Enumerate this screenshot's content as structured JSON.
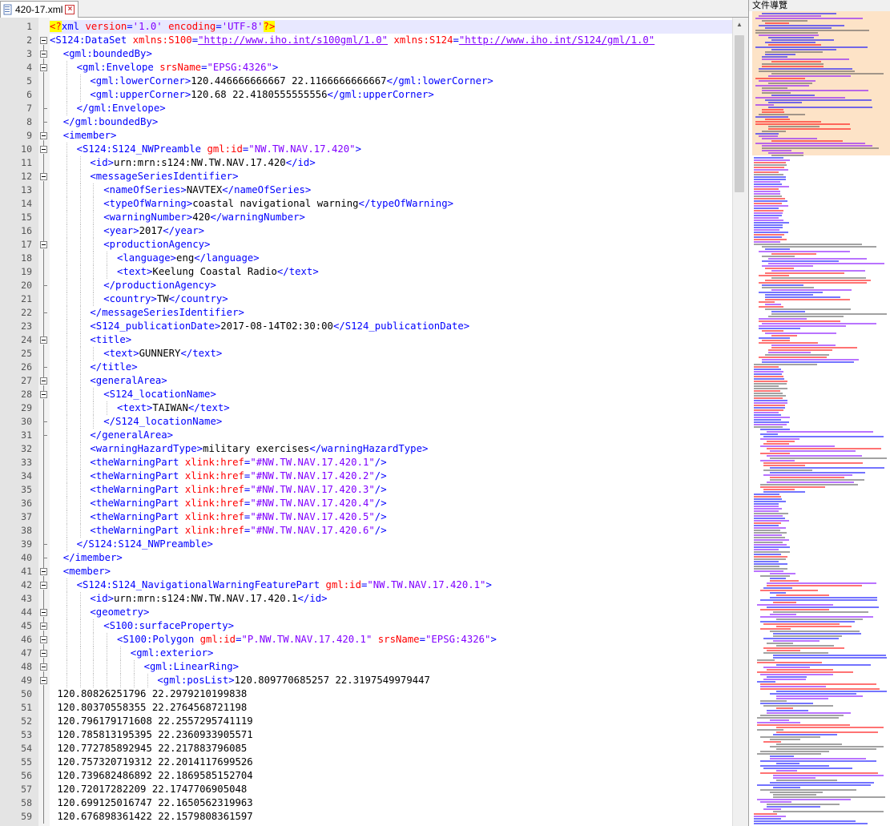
{
  "tab": {
    "filename": "420-17.xml",
    "close_symbol": "×"
  },
  "panel": {
    "title": "文件導覽"
  },
  "active_line": 1,
  "lines": [
    {
      "n": 1,
      "indent": 0,
      "segs": [
        [
          "pi",
          "<?"
        ],
        [
          "tag",
          "xml "
        ],
        [
          "attr",
          "version"
        ],
        [
          "tag",
          "="
        ],
        [
          "val",
          "'1.0'"
        ],
        [
          "tag",
          " "
        ],
        [
          "attr",
          "encoding"
        ],
        [
          "tag",
          "="
        ],
        [
          "val",
          "'UTF-8'"
        ],
        [
          "pi",
          "?>"
        ]
      ]
    },
    {
      "n": 2,
      "indent": 0,
      "fold": "open",
      "segs": [
        [
          "tag",
          "<S124:DataSet "
        ],
        [
          "attr",
          "xmlns:S100"
        ],
        [
          "tag",
          "="
        ],
        [
          "url",
          "\"http://www.iho.int/s100gml/1.0\""
        ],
        [
          "tag",
          " "
        ],
        [
          "attr",
          "xmlns:S124"
        ],
        [
          "tag",
          "="
        ],
        [
          "url",
          "\"http://www.iho.int/S124/gml/1.0\""
        ]
      ]
    },
    {
      "n": 3,
      "indent": 1,
      "fold": "open",
      "segs": [
        [
          "tag",
          "<gml:boundedBy>"
        ]
      ]
    },
    {
      "n": 4,
      "indent": 2,
      "fold": "open",
      "segs": [
        [
          "tag",
          "<gml:Envelope "
        ],
        [
          "attr",
          "srsName"
        ],
        [
          "tag",
          "="
        ],
        [
          "val",
          "\"EPSG:4326\""
        ],
        [
          "tag",
          ">"
        ]
      ]
    },
    {
      "n": 5,
      "indent": 3,
      "segs": [
        [
          "tag",
          "<gml:lowerCorner>"
        ],
        [
          "text",
          "120.446666666667 22.1166666666667"
        ],
        [
          "tag",
          "</gml:lowerCorner>"
        ]
      ]
    },
    {
      "n": 6,
      "indent": 3,
      "segs": [
        [
          "tag",
          "<gml:upperCorner>"
        ],
        [
          "text",
          "120.68 22.4180555555556"
        ],
        [
          "tag",
          "</gml:upperCorner>"
        ]
      ]
    },
    {
      "n": 7,
      "indent": 2,
      "fold": "end",
      "segs": [
        [
          "tag",
          "</gml:Envelope>"
        ]
      ]
    },
    {
      "n": 8,
      "indent": 1,
      "fold": "end",
      "segs": [
        [
          "tag",
          "</gml:boundedBy>"
        ]
      ]
    },
    {
      "n": 9,
      "indent": 1,
      "fold": "open",
      "segs": [
        [
          "tag",
          "<imember>"
        ]
      ]
    },
    {
      "n": 10,
      "indent": 2,
      "fold": "open",
      "segs": [
        [
          "tag",
          "<S124:S124_NWPreamble "
        ],
        [
          "attr",
          "gml:id"
        ],
        [
          "tag",
          "="
        ],
        [
          "val",
          "\"NW.TW.NAV.17.420\""
        ],
        [
          "tag",
          ">"
        ]
      ]
    },
    {
      "n": 11,
      "indent": 3,
      "segs": [
        [
          "tag",
          "<id>"
        ],
        [
          "text",
          "urn:mrn:s124:NW.TW.NAV.17.420"
        ],
        [
          "tag",
          "</id>"
        ]
      ]
    },
    {
      "n": 12,
      "indent": 3,
      "fold": "open",
      "segs": [
        [
          "tag",
          "<messageSeriesIdentifier>"
        ]
      ]
    },
    {
      "n": 13,
      "indent": 4,
      "segs": [
        [
          "tag",
          "<nameOfSeries>"
        ],
        [
          "text",
          "NAVTEX"
        ],
        [
          "tag",
          "</nameOfSeries>"
        ]
      ]
    },
    {
      "n": 14,
      "indent": 4,
      "segs": [
        [
          "tag",
          "<typeOfWarning>"
        ],
        [
          "text",
          "coastal navigational warning"
        ],
        [
          "tag",
          "</typeOfWarning>"
        ]
      ]
    },
    {
      "n": 15,
      "indent": 4,
      "segs": [
        [
          "tag",
          "<warningNumber>"
        ],
        [
          "text",
          "420"
        ],
        [
          "tag",
          "</warningNumber>"
        ]
      ]
    },
    {
      "n": 16,
      "indent": 4,
      "segs": [
        [
          "tag",
          "<year>"
        ],
        [
          "text",
          "2017"
        ],
        [
          "tag",
          "</year>"
        ]
      ]
    },
    {
      "n": 17,
      "indent": 4,
      "fold": "open",
      "segs": [
        [
          "tag",
          "<productionAgency>"
        ]
      ]
    },
    {
      "n": 18,
      "indent": 5,
      "segs": [
        [
          "tag",
          "<language>"
        ],
        [
          "text",
          "eng"
        ],
        [
          "tag",
          "</language>"
        ]
      ]
    },
    {
      "n": 19,
      "indent": 5,
      "segs": [
        [
          "tag",
          "<text>"
        ],
        [
          "text",
          "Keelung Coastal Radio"
        ],
        [
          "tag",
          "</text>"
        ]
      ]
    },
    {
      "n": 20,
      "indent": 4,
      "fold": "end",
      "segs": [
        [
          "tag",
          "</productionAgency>"
        ]
      ]
    },
    {
      "n": 21,
      "indent": 4,
      "segs": [
        [
          "tag",
          "<country>"
        ],
        [
          "text",
          "TW"
        ],
        [
          "tag",
          "</country>"
        ]
      ]
    },
    {
      "n": 22,
      "indent": 3,
      "fold": "end",
      "segs": [
        [
          "tag",
          "</messageSeriesIdentifier>"
        ]
      ]
    },
    {
      "n": 23,
      "indent": 3,
      "segs": [
        [
          "tag",
          "<S124_publicationDate>"
        ],
        [
          "text",
          "2017-08-14T02:30:00"
        ],
        [
          "tag",
          "</S124_publicationDate>"
        ]
      ]
    },
    {
      "n": 24,
      "indent": 3,
      "fold": "open",
      "segs": [
        [
          "tag",
          "<title>"
        ]
      ]
    },
    {
      "n": 25,
      "indent": 4,
      "segs": [
        [
          "tag",
          "<text>"
        ],
        [
          "text",
          "GUNNERY"
        ],
        [
          "tag",
          "</text>"
        ]
      ]
    },
    {
      "n": 26,
      "indent": 3,
      "fold": "end",
      "segs": [
        [
          "tag",
          "</title>"
        ]
      ]
    },
    {
      "n": 27,
      "indent": 3,
      "fold": "open",
      "segs": [
        [
          "tag",
          "<generalArea>"
        ]
      ]
    },
    {
      "n": 28,
      "indent": 4,
      "fold": "open",
      "segs": [
        [
          "tag",
          "<S124_locationName>"
        ]
      ]
    },
    {
      "n": 29,
      "indent": 5,
      "segs": [
        [
          "tag",
          "<text>"
        ],
        [
          "text",
          "TAIWAN"
        ],
        [
          "tag",
          "</text>"
        ]
      ]
    },
    {
      "n": 30,
      "indent": 4,
      "fold": "end",
      "segs": [
        [
          "tag",
          "</S124_locationName>"
        ]
      ]
    },
    {
      "n": 31,
      "indent": 3,
      "fold": "end",
      "segs": [
        [
          "tag",
          "</generalArea>"
        ]
      ]
    },
    {
      "n": 32,
      "indent": 3,
      "segs": [
        [
          "tag",
          "<warningHazardType>"
        ],
        [
          "text",
          "military exercises"
        ],
        [
          "tag",
          "</warningHazardType>"
        ]
      ]
    },
    {
      "n": 33,
      "indent": 3,
      "segs": [
        [
          "tag",
          "<theWarningPart "
        ],
        [
          "attr",
          "xlink:href"
        ],
        [
          "tag",
          "="
        ],
        [
          "val",
          "\"#NW.TW.NAV.17.420.1\""
        ],
        [
          "tag",
          "/>"
        ]
      ]
    },
    {
      "n": 34,
      "indent": 3,
      "segs": [
        [
          "tag",
          "<theWarningPart "
        ],
        [
          "attr",
          "xlink:href"
        ],
        [
          "tag",
          "="
        ],
        [
          "val",
          "\"#NW.TW.NAV.17.420.2\""
        ],
        [
          "tag",
          "/>"
        ]
      ]
    },
    {
      "n": 35,
      "indent": 3,
      "segs": [
        [
          "tag",
          "<theWarningPart "
        ],
        [
          "attr",
          "xlink:href"
        ],
        [
          "tag",
          "="
        ],
        [
          "val",
          "\"#NW.TW.NAV.17.420.3\""
        ],
        [
          "tag",
          "/>"
        ]
      ]
    },
    {
      "n": 36,
      "indent": 3,
      "segs": [
        [
          "tag",
          "<theWarningPart "
        ],
        [
          "attr",
          "xlink:href"
        ],
        [
          "tag",
          "="
        ],
        [
          "val",
          "\"#NW.TW.NAV.17.420.4\""
        ],
        [
          "tag",
          "/>"
        ]
      ]
    },
    {
      "n": 37,
      "indent": 3,
      "segs": [
        [
          "tag",
          "<theWarningPart "
        ],
        [
          "attr",
          "xlink:href"
        ],
        [
          "tag",
          "="
        ],
        [
          "val",
          "\"#NW.TW.NAV.17.420.5\""
        ],
        [
          "tag",
          "/>"
        ]
      ]
    },
    {
      "n": 38,
      "indent": 3,
      "segs": [
        [
          "tag",
          "<theWarningPart "
        ],
        [
          "attr",
          "xlink:href"
        ],
        [
          "tag",
          "="
        ],
        [
          "val",
          "\"#NW.TW.NAV.17.420.6\""
        ],
        [
          "tag",
          "/>"
        ]
      ]
    },
    {
      "n": 39,
      "indent": 2,
      "fold": "end",
      "segs": [
        [
          "tag",
          "</S124:S124_NWPreamble>"
        ]
      ]
    },
    {
      "n": 40,
      "indent": 1,
      "fold": "end",
      "segs": [
        [
          "tag",
          "</imember>"
        ]
      ]
    },
    {
      "n": 41,
      "indent": 1,
      "fold": "open",
      "segs": [
        [
          "tag",
          "<member>"
        ]
      ]
    },
    {
      "n": 42,
      "indent": 2,
      "fold": "open",
      "segs": [
        [
          "tag",
          "<S124:S124_NavigationalWarningFeaturePart "
        ],
        [
          "attr",
          "gml:id"
        ],
        [
          "tag",
          "="
        ],
        [
          "val",
          "\"NW.TW.NAV.17.420.1\""
        ],
        [
          "tag",
          ">"
        ]
      ]
    },
    {
      "n": 43,
      "indent": 3,
      "segs": [
        [
          "tag",
          "<id>"
        ],
        [
          "text",
          "urn:mrn:s124:NW.TW.NAV.17.420.1"
        ],
        [
          "tag",
          "</id>"
        ]
      ]
    },
    {
      "n": 44,
      "indent": 3,
      "fold": "open",
      "segs": [
        [
          "tag",
          "<geometry>"
        ]
      ]
    },
    {
      "n": 45,
      "indent": 4,
      "fold": "open",
      "segs": [
        [
          "tag",
          "<S100:surfaceProperty>"
        ]
      ]
    },
    {
      "n": 46,
      "indent": 5,
      "fold": "open",
      "segs": [
        [
          "tag",
          "<S100:Polygon "
        ],
        [
          "attr",
          "gml:id"
        ],
        [
          "tag",
          "="
        ],
        [
          "val",
          "\"P.NW.TW.NAV.17.420.1\""
        ],
        [
          "tag",
          " "
        ],
        [
          "attr",
          "srsName"
        ],
        [
          "tag",
          "="
        ],
        [
          "val",
          "\"EPSG:4326\""
        ],
        [
          "tag",
          ">"
        ]
      ]
    },
    {
      "n": 47,
      "indent": 6,
      "fold": "open",
      "segs": [
        [
          "tag",
          "<gml:exterior>"
        ]
      ]
    },
    {
      "n": 48,
      "indent": 7,
      "fold": "open",
      "segs": [
        [
          "tag",
          "<gml:LinearRing>"
        ]
      ]
    },
    {
      "n": 49,
      "indent": 8,
      "fold": "open",
      "segs": [
        [
          "tag",
          "<gml:posList>"
        ],
        [
          "text",
          "120.809770685257 22.3197549979447"
        ]
      ]
    },
    {
      "n": 50,
      "indent": 0,
      "raw": true,
      "segs": [
        [
          "text",
          " 120.80826251796 22.2979210199838"
        ]
      ]
    },
    {
      "n": 51,
      "indent": 0,
      "raw": true,
      "segs": [
        [
          "text",
          " 120.80370558355 22.2764568721198"
        ]
      ]
    },
    {
      "n": 52,
      "indent": 0,
      "raw": true,
      "segs": [
        [
          "text",
          " 120.796179171608 22.2557295741119"
        ]
      ]
    },
    {
      "n": 53,
      "indent": 0,
      "raw": true,
      "segs": [
        [
          "text",
          " 120.785813195395 22.2360933905571"
        ]
      ]
    },
    {
      "n": 54,
      "indent": 0,
      "raw": true,
      "segs": [
        [
          "text",
          " 120.772785892945 22.217883796085"
        ]
      ]
    },
    {
      "n": 55,
      "indent": 0,
      "raw": true,
      "segs": [
        [
          "text",
          " 120.757320719312 22.2014117699526"
        ]
      ]
    },
    {
      "n": 56,
      "indent": 0,
      "raw": true,
      "segs": [
        [
          "text",
          " 120.739682486892 22.1869585152704"
        ]
      ]
    },
    {
      "n": 57,
      "indent": 0,
      "raw": true,
      "segs": [
        [
          "text",
          " 120.72017282209 22.1747706905048"
        ]
      ]
    },
    {
      "n": 58,
      "indent": 0,
      "raw": true,
      "segs": [
        [
          "text",
          " 120.699125016747 22.1650562319963"
        ]
      ]
    },
    {
      "n": 59,
      "indent": 0,
      "raw": true,
      "segs": [
        [
          "text",
          " 120.676898361422 22.1579808361597"
        ]
      ]
    }
  ],
  "colors": {
    "tag": "#0000ff",
    "attr": "#ff0000",
    "val": "#8000ff",
    "text": "#000000",
    "pi_bg": "#ffff00"
  }
}
